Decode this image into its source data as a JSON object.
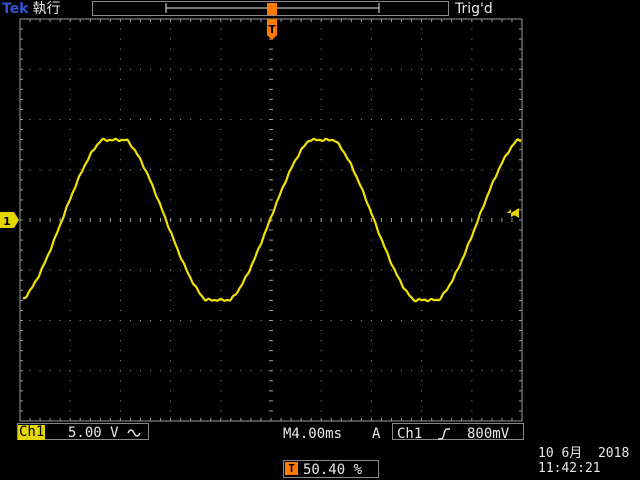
{
  "header": {
    "brand": "Tek",
    "acq_state": "執行",
    "trig_status": "Trig'd"
  },
  "markers": {
    "trigger_marker": "T",
    "channel_marker": "1"
  },
  "channel": {
    "label": "Ch1",
    "scale": "5.00 V",
    "coupling_icon": "ac-coupling-icon",
    "color": "#e4d700"
  },
  "timebase": {
    "value": "M4.00ms"
  },
  "trigger": {
    "mode": "A",
    "source": "Ch1",
    "slope_icon": "rising-edge-icon",
    "level": "800mV",
    "position_value": "50.40 %",
    "position_icon": "T",
    "marker_color": "#ff7a00"
  },
  "datetime": {
    "date": "10 6月  2018",
    "time": "11:42:21"
  },
  "waveform": {
    "color": "#f2e200",
    "grid_color": "#9a9a9a"
  }
}
